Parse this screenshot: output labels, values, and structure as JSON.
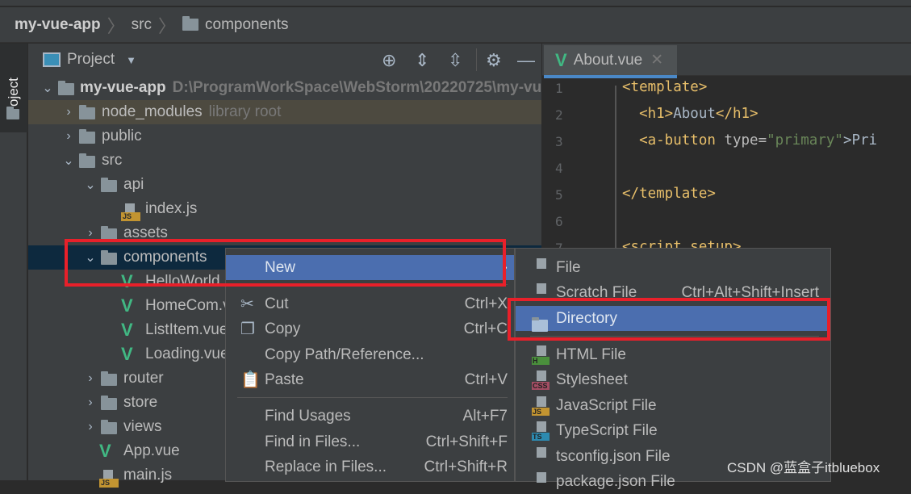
{
  "breadcrumb": [
    "my-vue-app",
    "src",
    "components"
  ],
  "tool_strip": {
    "label": "Project"
  },
  "panel": {
    "title": "Project"
  },
  "tree": [
    {
      "label": "my-vue-app",
      "hint": "D:\\ProgramWorkSpace\\WebStorm\\20220725\\my-vu",
      "level": 0,
      "type": "folder",
      "expanded": true,
      "bold": true
    },
    {
      "label": "node_modules",
      "hint": "library root",
      "level": 1,
      "type": "folder",
      "expanded": false,
      "lib": true
    },
    {
      "label": "public",
      "level": 1,
      "type": "folder",
      "expanded": false
    },
    {
      "label": "src",
      "level": 1,
      "type": "folder",
      "expanded": true
    },
    {
      "label": "api",
      "level": 2,
      "type": "folder",
      "expanded": true
    },
    {
      "label": "index.js",
      "level": 3,
      "type": "js"
    },
    {
      "label": "assets",
      "level": 2,
      "type": "folder",
      "expanded": false
    },
    {
      "label": "components",
      "level": 2,
      "type": "folder",
      "expanded": true,
      "selected": true
    },
    {
      "label": "HelloWorld",
      "level": 3,
      "type": "vue"
    },
    {
      "label": "HomeCom.v",
      "level": 3,
      "type": "vue"
    },
    {
      "label": "ListItem.vue",
      "level": 3,
      "type": "vue"
    },
    {
      "label": "Loading.vue",
      "level": 3,
      "type": "vue"
    },
    {
      "label": "router",
      "level": 2,
      "type": "folder",
      "expanded": false
    },
    {
      "label": "store",
      "level": 2,
      "type": "folder",
      "expanded": false
    },
    {
      "label": "views",
      "level": 2,
      "type": "folder",
      "expanded": false
    },
    {
      "label": "App.vue",
      "level": 2,
      "type": "vue"
    },
    {
      "label": "main.js",
      "level": 2,
      "type": "js"
    }
  ],
  "editor": {
    "tab": "About.vue",
    "line_numbers": [
      "1",
      "2",
      "3",
      "4",
      "5",
      "6",
      "7"
    ],
    "lines": [
      [
        [
          "<template>",
          "tag"
        ]
      ],
      [
        [
          "  <h1>",
          "tag"
        ],
        [
          "About",
          "text"
        ],
        [
          "</h1>",
          "tag"
        ]
      ],
      [
        [
          "  <a-button ",
          "tag"
        ],
        [
          "type=",
          "attr"
        ],
        [
          "\"primary\"",
          "str"
        ],
        [
          ">Pri",
          "text"
        ]
      ],
      [],
      [
        [
          "</template>",
          "tag"
        ]
      ],
      [],
      [
        [
          "<script setup>",
          "tag"
        ]
      ]
    ]
  },
  "context_menu": {
    "items": [
      {
        "label": "New",
        "shortcut": "›",
        "highlight": true
      },
      {
        "label": "Cut",
        "shortcut": "Ctrl+X",
        "icon": "scissors-icon"
      },
      {
        "label": "Copy",
        "shortcut": "Ctrl+C",
        "icon": "copy-icon"
      },
      {
        "label": "Copy Path/Reference...",
        "shortcut": ""
      },
      {
        "label": "Paste",
        "shortcut": "Ctrl+V",
        "icon": "clipboard-icon"
      },
      {
        "label": "Find Usages",
        "shortcut": "Alt+F7"
      },
      {
        "label": "Find in Files...",
        "shortcut": "Ctrl+Shift+F"
      },
      {
        "label": "Replace in Files...",
        "shortcut": "Ctrl+Shift+R"
      }
    ]
  },
  "submenu": {
    "items": [
      {
        "label": "File",
        "shortcut": "",
        "icon": "file-icon"
      },
      {
        "label": "Scratch File",
        "shortcut": "Ctrl+Alt+Shift+Insert",
        "icon": "scratch-file-icon"
      },
      {
        "label": "Directory",
        "shortcut": "",
        "icon": "folder-icon",
        "highlight": true
      },
      {
        "label": "HTML File",
        "badge": "H",
        "color": "#4a8f3c",
        "icon": "html-file-icon"
      },
      {
        "label": "Stylesheet",
        "badge": "CSS",
        "color": "#a34d63",
        "icon": "css-file-icon"
      },
      {
        "label": "JavaScript File",
        "badge": "JS",
        "color": "#c29431",
        "icon": "js-file-icon"
      },
      {
        "label": "TypeScript File",
        "badge": "TS",
        "color": "#2c8ab0",
        "icon": "ts-file-icon"
      },
      {
        "label": "tsconfig.json File",
        "icon": "tsconfig-file-icon"
      },
      {
        "label": "package.json File",
        "icon": "package-json-icon"
      }
    ]
  },
  "watermark": "CSDN @蓝盒子itbluebox",
  "colors": {
    "highlight": "#4b6eaf",
    "annotation": "#e8202a",
    "vue": "#41b883"
  }
}
